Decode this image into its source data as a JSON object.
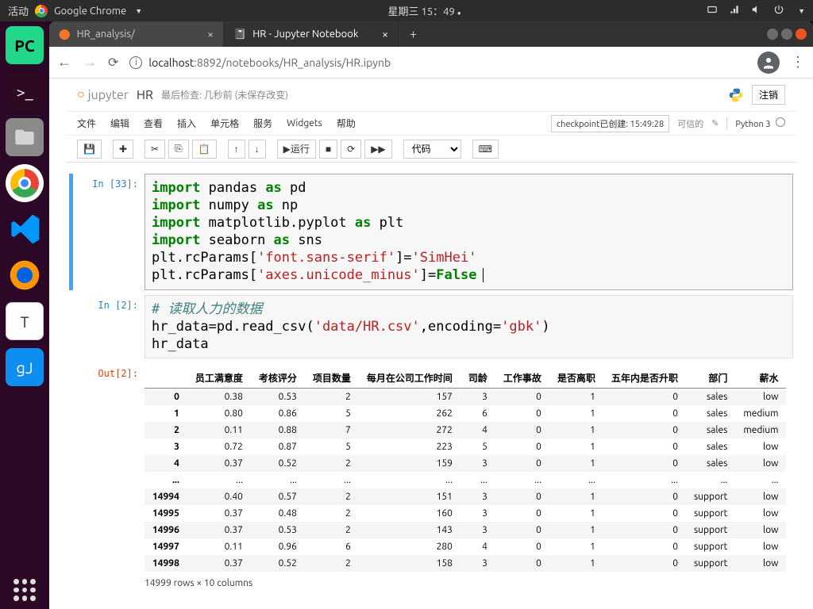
{
  "topbar": {
    "activities": "活动",
    "app": "Google Chrome",
    "datetime": "星期三 15：49"
  },
  "browser": {
    "tabs": [
      {
        "title": "HR_analysis/",
        "active": false
      },
      {
        "title": "HR - Jupyter Notebook",
        "active": true
      }
    ],
    "url_host": "localhost",
    "url_path": ":8892/notebooks/HR_analysis/HR.ipynb"
  },
  "jupyter": {
    "brand": "jupyter",
    "title": "HR",
    "checkpoint": "最后检查: 几秒前",
    "unsaved": "(未保存改变)",
    "logout": "注销",
    "menu": [
      "文件",
      "编辑",
      "查看",
      "插入",
      "单元格",
      "服务",
      "Widgets",
      "帮助"
    ],
    "checkpoint_created": "checkpoint已创建: 15:49:28",
    "trusted": "可信的",
    "kernel": "Python 3",
    "toolbar": {
      "run": "运行",
      "celltype": "代码"
    }
  },
  "cells": [
    {
      "prompt": "In [33]:",
      "selected": true,
      "code_tokens": [
        [
          {
            "t": "import",
            "c": "kw"
          },
          {
            "t": " pandas "
          },
          {
            "t": "as",
            "c": "kw"
          },
          {
            "t": " pd"
          }
        ],
        [
          {
            "t": "import",
            "c": "kw"
          },
          {
            "t": " numpy "
          },
          {
            "t": "as",
            "c": "kw"
          },
          {
            "t": " np"
          }
        ],
        [
          {
            "t": "import",
            "c": "kw"
          },
          {
            "t": " matplotlib.pyplot "
          },
          {
            "t": "as",
            "c": "kw"
          },
          {
            "t": " plt"
          }
        ],
        [
          {
            "t": "import",
            "c": "kw"
          },
          {
            "t": " seaborn "
          },
          {
            "t": "as",
            "c": "kw"
          },
          {
            "t": " sns"
          }
        ],
        [
          {
            "t": "plt.rcParams["
          },
          {
            "t": "'font.sans-serif'",
            "c": "str"
          },
          {
            "t": "]="
          },
          {
            "t": "'SimHei'",
            "c": "str"
          }
        ],
        [
          {
            "t": "plt.rcParams["
          },
          {
            "t": "'axes.unicode_minus'",
            "c": "str"
          },
          {
            "t": "]="
          },
          {
            "t": "False",
            "c": "bool"
          }
        ]
      ]
    },
    {
      "prompt": "In [2]:",
      "code_tokens": [
        [
          {
            "t": "# 读取人力的数据",
            "c": "cmt"
          }
        ],
        [
          {
            "t": "hr_data=pd.read_csv("
          },
          {
            "t": "'data/HR.csv'",
            "c": "str"
          },
          {
            "t": ",encoding="
          },
          {
            "t": "'gbk'",
            "c": "str"
          },
          {
            "t": ")"
          }
        ],
        [
          {
            "t": "hr_data"
          }
        ]
      ],
      "out_prompt": "Out[2]:"
    }
  ],
  "dataframe": {
    "columns": [
      "员工满意度",
      "考核评分",
      "项目数量",
      "每月在公司工作时间",
      "司龄",
      "工作事故",
      "是否离职",
      "五年内是否升职",
      "部门",
      "薪水"
    ],
    "rows": [
      {
        "idx": "0",
        "v": [
          "0.38",
          "0.53",
          "2",
          "157",
          "3",
          "0",
          "1",
          "0",
          "sales",
          "low"
        ]
      },
      {
        "idx": "1",
        "v": [
          "0.80",
          "0.86",
          "5",
          "262",
          "6",
          "0",
          "1",
          "0",
          "sales",
          "medium"
        ]
      },
      {
        "idx": "2",
        "v": [
          "0.11",
          "0.88",
          "7",
          "272",
          "4",
          "0",
          "1",
          "0",
          "sales",
          "medium"
        ]
      },
      {
        "idx": "3",
        "v": [
          "0.72",
          "0.87",
          "5",
          "223",
          "5",
          "0",
          "1",
          "0",
          "sales",
          "low"
        ]
      },
      {
        "idx": "4",
        "v": [
          "0.37",
          "0.52",
          "2",
          "159",
          "3",
          "0",
          "1",
          "0",
          "sales",
          "low"
        ]
      },
      {
        "idx": "...",
        "v": [
          "...",
          "...",
          "...",
          "...",
          "...",
          "...",
          "...",
          "...",
          "...",
          "..."
        ]
      },
      {
        "idx": "14994",
        "v": [
          "0.40",
          "0.57",
          "2",
          "151",
          "3",
          "0",
          "1",
          "0",
          "support",
          "low"
        ]
      },
      {
        "idx": "14995",
        "v": [
          "0.37",
          "0.48",
          "2",
          "160",
          "3",
          "0",
          "1",
          "0",
          "support",
          "low"
        ]
      },
      {
        "idx": "14996",
        "v": [
          "0.37",
          "0.53",
          "2",
          "143",
          "3",
          "0",
          "1",
          "0",
          "support",
          "low"
        ]
      },
      {
        "idx": "14997",
        "v": [
          "0.11",
          "0.96",
          "6",
          "280",
          "4",
          "0",
          "1",
          "0",
          "support",
          "low"
        ]
      },
      {
        "idx": "14998",
        "v": [
          "0.37",
          "0.52",
          "2",
          "158",
          "3",
          "0",
          "1",
          "0",
          "support",
          "low"
        ]
      }
    ],
    "caption": "14999 rows × 10 columns"
  }
}
